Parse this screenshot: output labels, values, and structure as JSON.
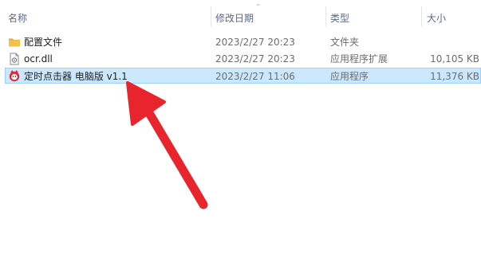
{
  "columns": {
    "name": "名称",
    "modified": "修改日期",
    "type": "类型",
    "size": "大小"
  },
  "files": [
    {
      "icon": "folder-icon",
      "name": "配置文件",
      "modified": "2023/2/27 20:23",
      "type": "文件夹",
      "size": ""
    },
    {
      "icon": "dll-file-icon",
      "name": "ocr.dll",
      "modified": "2023/2/27 20:23",
      "type": "应用程序扩展",
      "size": "10,105 KB"
    },
    {
      "icon": "app-icon",
      "name": "定时点击器 电脑版 v1.1",
      "modified": "2023/2/27 11:06",
      "type": "应用程序",
      "size": "11,376 KB"
    }
  ],
  "colors": {
    "selection_bg": "#cce8ff",
    "selection_border": "#99d1ff",
    "arrow": "#e8242d",
    "folder": "#f5c04a"
  }
}
